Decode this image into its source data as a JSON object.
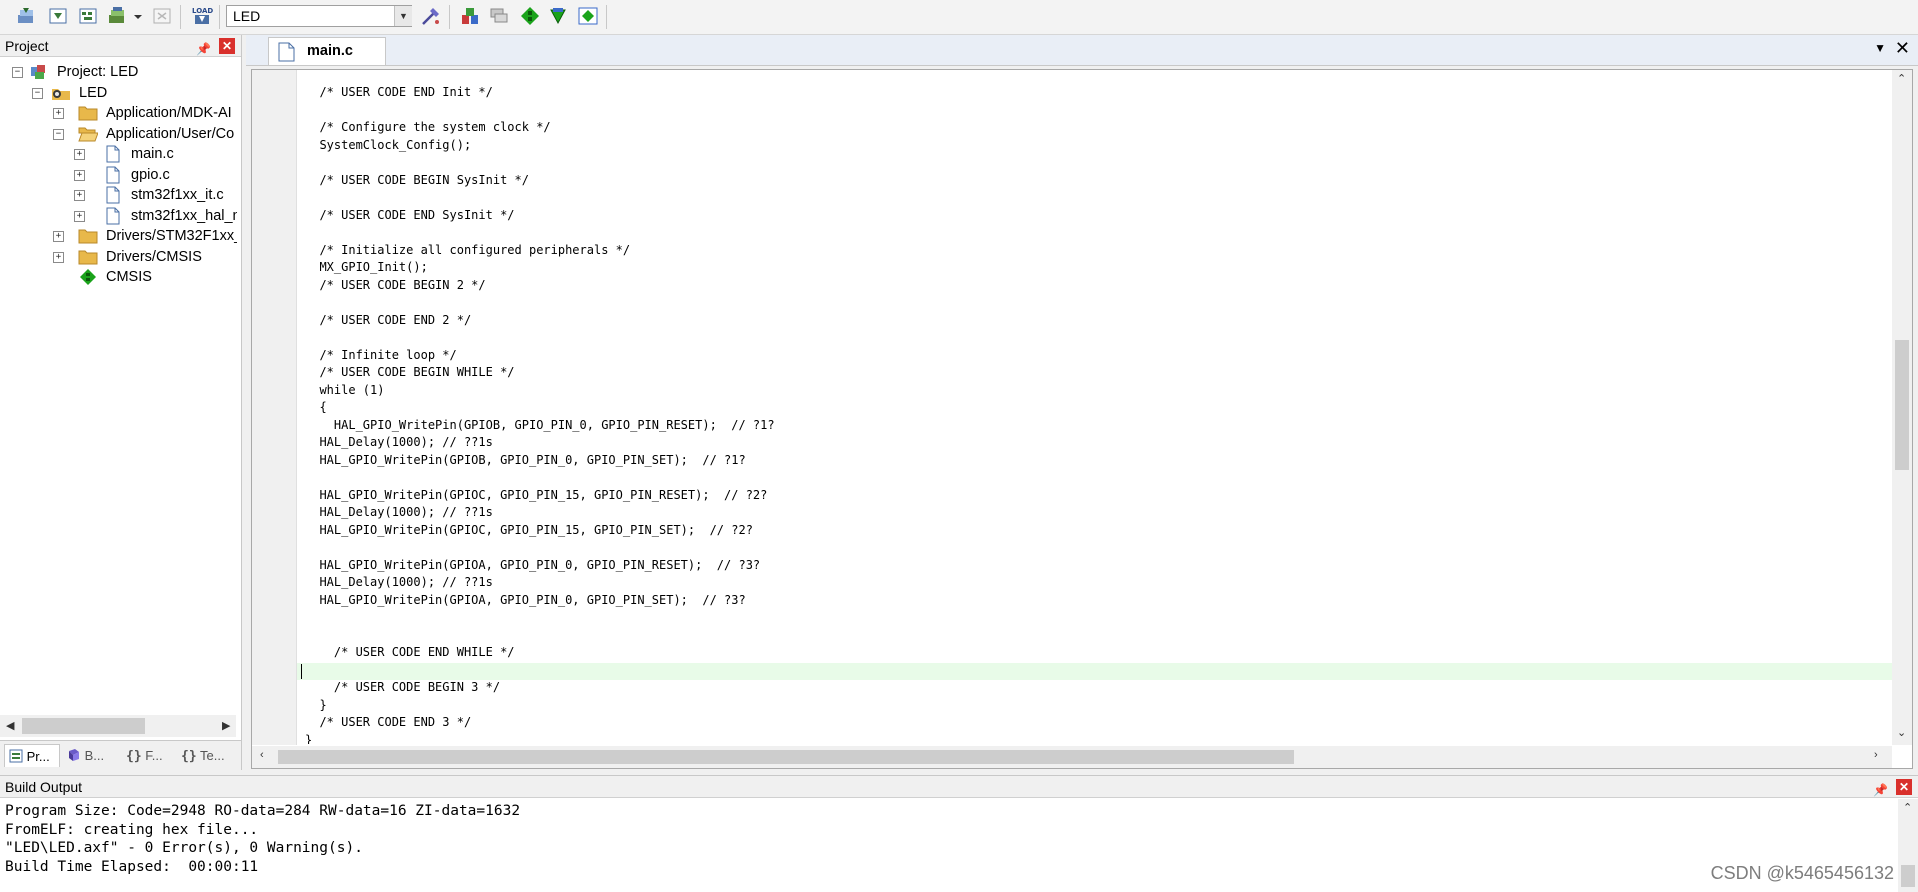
{
  "toolbar": {
    "target_name": "LED",
    "buttons": [
      {
        "name": "translate-icon"
      },
      {
        "name": "build-icon"
      },
      {
        "name": "rebuild-icon"
      },
      {
        "name": "batch-build-icon"
      },
      {
        "name": "stop-build-icon"
      },
      {
        "name": "download-icon",
        "text": "LOAD"
      },
      {
        "name": "target-options-icon"
      },
      {
        "name": "manage-project-items-icon"
      },
      {
        "name": "select-packs-icon"
      },
      {
        "name": "pack-installer-icon"
      },
      {
        "name": "manage-rte-icon"
      },
      {
        "name": "run-time-env-icon"
      }
    ]
  },
  "project_panel": {
    "title": "Project",
    "tree": [
      {
        "label": "Project: LED",
        "icon": "project-icon",
        "level": 0,
        "expander": "−"
      },
      {
        "label": "LED",
        "icon": "target-icon",
        "level": 1,
        "expander": "−"
      },
      {
        "label": "Application/MDK-AI",
        "icon": "folder-icon",
        "level": 2,
        "expander": "+"
      },
      {
        "label": "Application/User/Co",
        "icon": "folder-open-icon",
        "level": 2,
        "expander": "−"
      },
      {
        "label": "main.c",
        "icon": "file-icon",
        "level": 3,
        "expander": "+"
      },
      {
        "label": "gpio.c",
        "icon": "file-icon",
        "level": 3,
        "expander": "+"
      },
      {
        "label": "stm32f1xx_it.c",
        "icon": "file-icon",
        "level": 3,
        "expander": "+"
      },
      {
        "label": "stm32f1xx_hal_n",
        "icon": "file-icon",
        "level": 3,
        "expander": "+"
      },
      {
        "label": "Drivers/STM32F1xx_",
        "icon": "folder-icon",
        "level": 2,
        "expander": "+"
      },
      {
        "label": "Drivers/CMSIS",
        "icon": "folder-icon",
        "level": 2,
        "expander": "+"
      },
      {
        "label": "CMSIS",
        "icon": "cmsis-icon",
        "level": 2,
        "expander": ""
      }
    ],
    "tabs": [
      {
        "label": "Pr...",
        "icon": "project-tab-icon",
        "active": true
      },
      {
        "label": "B...",
        "icon": "books-tab-icon",
        "active": false
      },
      {
        "label": "F...",
        "icon": "functions-tab-icon",
        "active": false
      },
      {
        "label": "Te...",
        "icon": "templates-tab-icon",
        "active": false
      }
    ]
  },
  "editor": {
    "active_tab": "main.c",
    "code_lines": [
      "  /* USER CODE END Init */",
      "",
      "  /* Configure the system clock */",
      "  SystemClock_Config();",
      "",
      "  /* USER CODE BEGIN SysInit */",
      "",
      "  /* USER CODE END SysInit */",
      "",
      "  /* Initialize all configured peripherals */",
      "  MX_GPIO_Init();",
      "  /* USER CODE BEGIN 2 */",
      "",
      "  /* USER CODE END 2 */",
      "",
      "  /* Infinite loop */",
      "  /* USER CODE BEGIN WHILE */",
      "  while (1)",
      "  {",
      "    HAL_GPIO_WritePin(GPIOB, GPIO_PIN_0, GPIO_PIN_RESET);  // ?1?",
      "  HAL_Delay(1000); // ??1s",
      "  HAL_GPIO_WritePin(GPIOB, GPIO_PIN_0, GPIO_PIN_SET);  // ?1?",
      "",
      "  HAL_GPIO_WritePin(GPIOC, GPIO_PIN_15, GPIO_PIN_RESET);  // ?2?",
      "  HAL_Delay(1000); // ??1s",
      "  HAL_GPIO_WritePin(GPIOC, GPIO_PIN_15, GPIO_PIN_SET);  // ?2?",
      "",
      "  HAL_GPIO_WritePin(GPIOA, GPIO_PIN_0, GPIO_PIN_RESET);  // ?3?",
      "  HAL_Delay(1000); // ??1s",
      "  HAL_GPIO_WritePin(GPIOA, GPIO_PIN_0, GPIO_PIN_SET);  // ?3?",
      "",
      "",
      "    /* USER CODE END WHILE */",
      "",
      "    /* USER CODE BEGIN 3 */",
      "  }",
      "  /* USER CODE END 3 */",
      "}"
    ]
  },
  "build_output": {
    "title": "Build Output",
    "lines": [
      "Program Size: Code=2948 RO-data=284 RW-data=16 ZI-data=1632",
      "FromELF: creating hex file...",
      "\"LED\\LED.axf\" - 0 Error(s), 0 Warning(s).",
      "Build Time Elapsed:  00:00:11"
    ]
  },
  "watermark": "CSDN @k5465456132",
  "colors": {
    "close_red": "#d9302c",
    "current_line": "#e8fbe8",
    "cmsis_green": "#1aa31a",
    "folder_yellow": "#e8b84a"
  }
}
